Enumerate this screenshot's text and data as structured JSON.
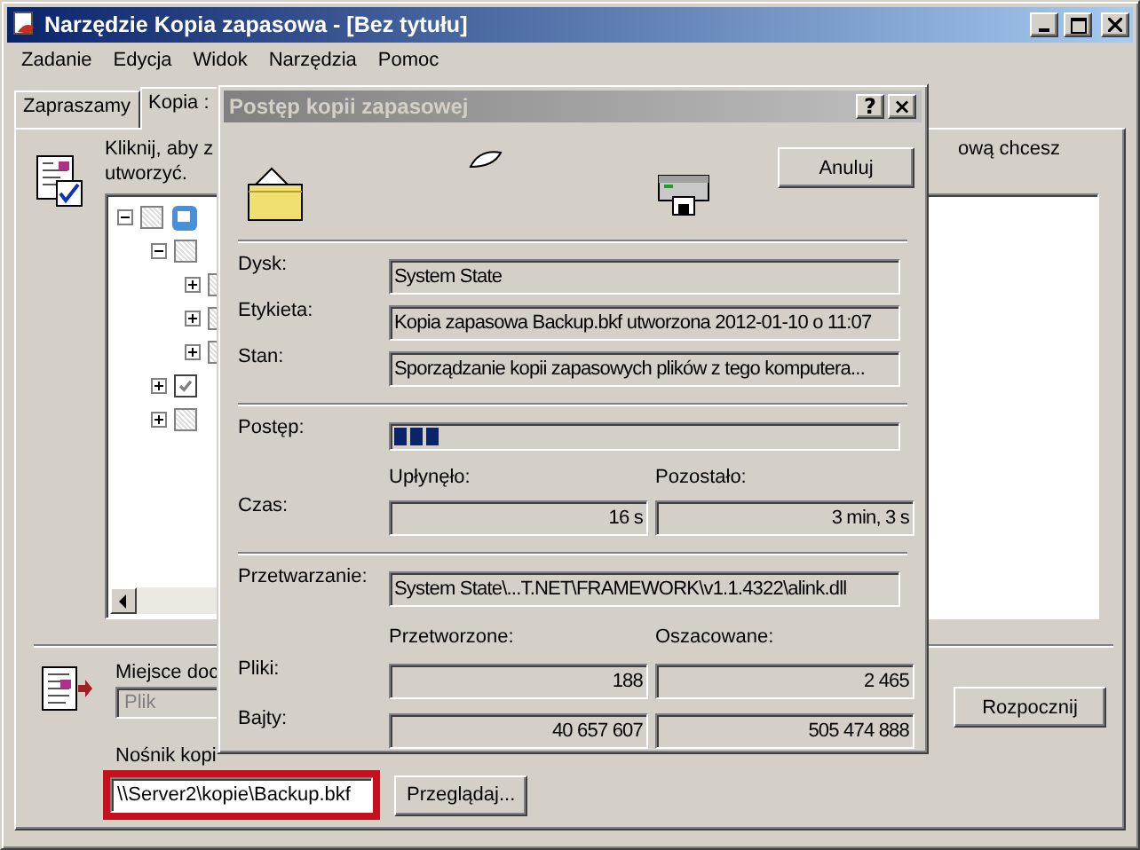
{
  "window": {
    "title": "Narzędzie Kopia zapasowa - [Bez tytułu]"
  },
  "menu": [
    "Zadanie",
    "Edycja",
    "Widok",
    "Narzędzia",
    "Pomoc"
  ],
  "tabs": [
    {
      "label": "Zapraszamy",
      "selected": false
    },
    {
      "label": "Kopia :",
      "selected": true
    }
  ],
  "backup_tab": {
    "instruction_lines": [
      "Kliknij, aby z",
      "utworzyć."
    ],
    "instruction_right": "ową chcesz",
    "tree": [
      {
        "expanded": true,
        "checked": false,
        "children": [
          {
            "expanded": true,
            "checked": false,
            "children": [
              {
                "expanded": false,
                "checked": false
              },
              {
                "expanded": false,
                "checked": false
              },
              {
                "expanded": false,
                "checked": false
              }
            ]
          },
          {
            "expanded": false,
            "checked": true
          },
          {
            "expanded": false,
            "checked": false
          }
        ]
      }
    ],
    "destination_label": "Miejsce doc",
    "destination_type": {
      "value": "Plik",
      "disabled": true
    },
    "media_label": "Nośnik kopi",
    "media_path": "\\\\Server2\\kopie\\Backup.bkf",
    "browse_button": "Przeglądaj...",
    "start_button": "Rozpocznij"
  },
  "dialog": {
    "title": "Postęp kopii zapasowej",
    "help_button": "?",
    "close_button": "×",
    "cancel_button": "Anuluj",
    "rows": [
      {
        "label": "Dysk:",
        "value": "System State"
      },
      {
        "label": "Etykieta:",
        "value": "Kopia zapasowa Backup.bkf utworzona 2012-01-10 o 11:07"
      },
      {
        "label": "Stan:",
        "value": "Sporządzanie kopii zapasowych plików z tego komputera..."
      }
    ],
    "progress": {
      "label": "Postęp:",
      "level": 0.09
    },
    "time": {
      "label": "Czas:",
      "columns": [
        "Upłynęło:",
        "Pozostało:"
      ],
      "values": [
        "16 s",
        "3 min, 3 s"
      ]
    },
    "processing": {
      "label": "Przetwarzanie:",
      "value": "System State\\...T.NET\\FRAMEWORK\\v1.1.4322\\alink.dll"
    },
    "counts": {
      "columns": [
        "Przetworzone:",
        "Oszacowane:"
      ],
      "rows": [
        {
          "label": "Pliki:",
          "values": [
            "188",
            "2 465"
          ]
        },
        {
          "label": "Bajty:",
          "values": [
            "40 657 607",
            "505 474 888"
          ]
        }
      ]
    }
  }
}
